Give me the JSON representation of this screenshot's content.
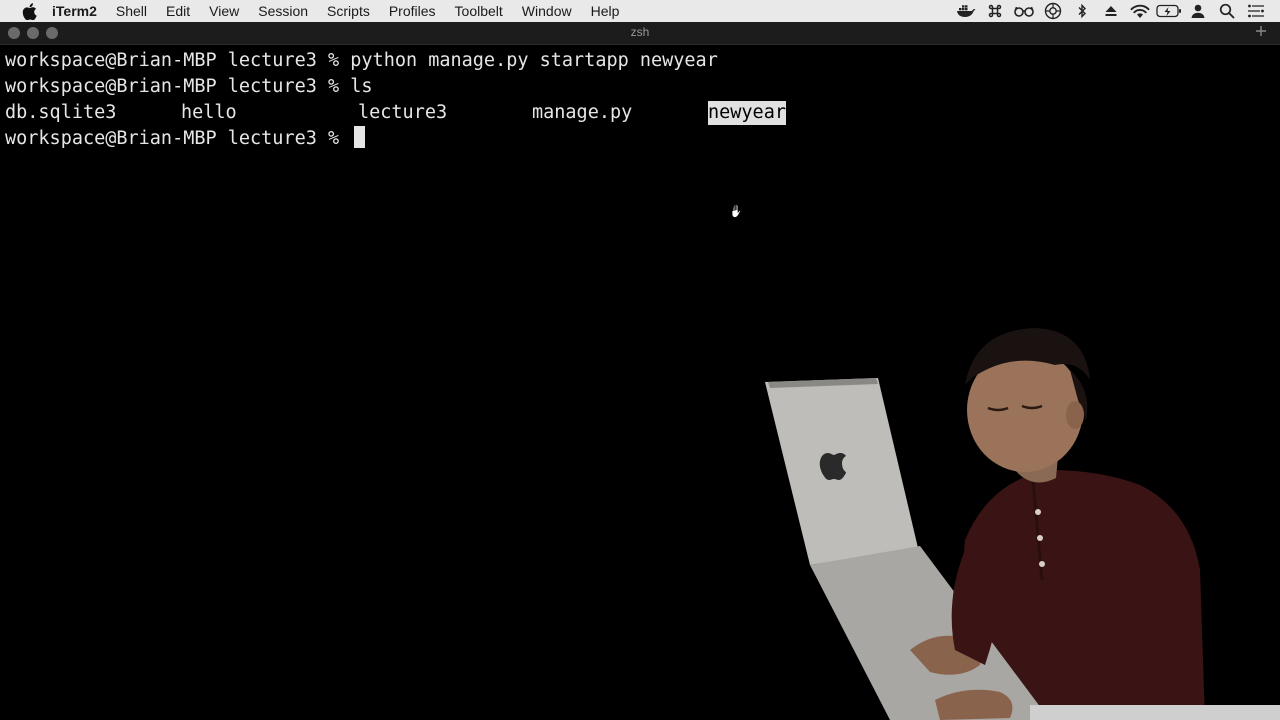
{
  "menubar": {
    "app_name": "iTerm2",
    "items": [
      "Shell",
      "Edit",
      "View",
      "Session",
      "Scripts",
      "Profiles",
      "Toolbelt",
      "Window",
      "Help"
    ],
    "status_icons": [
      "docker-icon",
      "command-icon",
      "glasses-icon",
      "openai-icon",
      "bluetooth-icon",
      "eject-icon",
      "wifi-icon",
      "battery-charging-icon",
      "user-icon",
      "search-icon",
      "control-center-icon"
    ]
  },
  "window": {
    "title": "zsh"
  },
  "terminal": {
    "lines": [
      {
        "prompt": "workspace@Brian-MBP lecture3 % ",
        "command": "python manage.py startapp newyear"
      },
      {
        "prompt": "workspace@Brian-MBP lecture3 % ",
        "command": "ls"
      }
    ],
    "ls_output": [
      "db.sqlite3",
      "hello",
      "lecture3",
      "manage.py",
      "newyear"
    ],
    "selected_item": "newyear",
    "current_prompt": "workspace@Brian-MBP lecture3 % "
  },
  "colors": {
    "menubar_bg": "#e9e9e9",
    "terminal_bg": "#000000",
    "terminal_fg": "#e6e6e6",
    "selection_bg": "#e0e0e0"
  }
}
